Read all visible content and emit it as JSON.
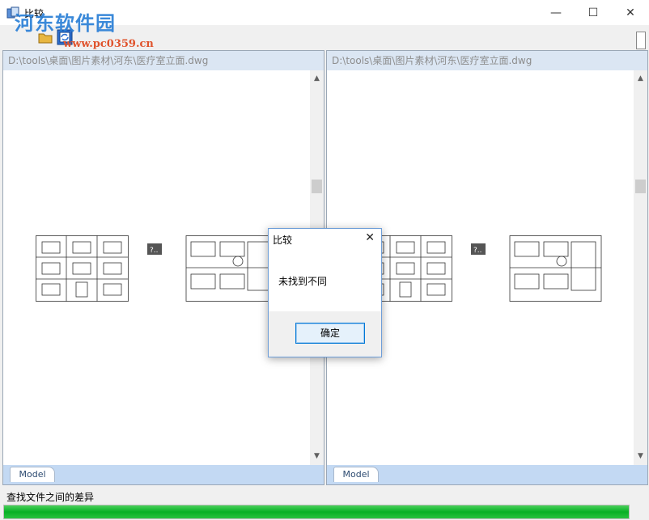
{
  "window": {
    "title": "比较",
    "minimize": "—",
    "maximize": "☐",
    "close": "✕"
  },
  "watermark": {
    "text": "河东软件园",
    "url": "www.pc0359.cn"
  },
  "left_pane": {
    "path": "D:\\tools\\桌面\\图片素材\\河东\\医疗室立面.dwg",
    "tab": "Model"
  },
  "right_pane": {
    "path": "D:\\tools\\桌面\\图片素材\\河东\\医疗室立面.dwg",
    "tab": "Model"
  },
  "status": {
    "text": "查找文件之间的差异",
    "progress": 1.0
  },
  "dialog": {
    "title": "比较",
    "close": "✕",
    "message": "未找到不同",
    "ok": "确定"
  },
  "icons": {
    "app": "compare-app-icon",
    "toolbar": [
      "open-icon",
      "refresh-compare-icon"
    ]
  },
  "colors": {
    "accent": "#0078d7",
    "progress": "#07b025",
    "pane_header": "#dbe6f3",
    "tabbar": "#c3d9f3"
  }
}
